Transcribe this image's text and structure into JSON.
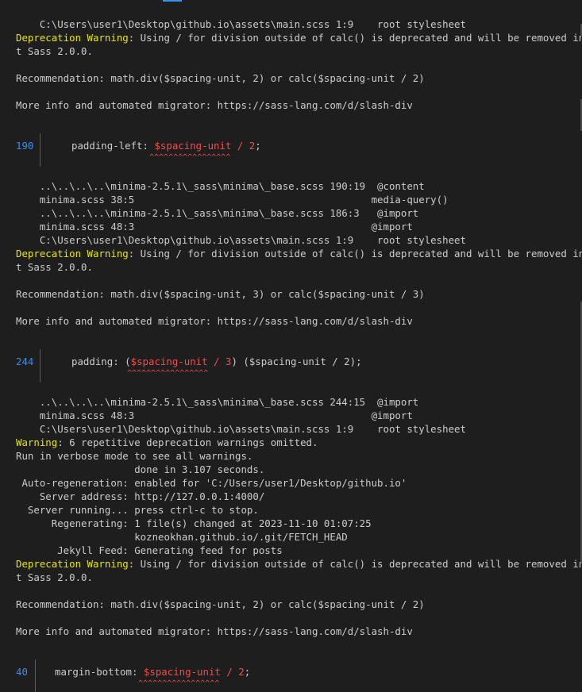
{
  "colors": {
    "background": "#1e1e1e",
    "text": "#cccccc",
    "warning": "#e5e510",
    "error": "#f14c4c",
    "line_number": "#3b8eea"
  },
  "terminal": {
    "lines": {
      "l0": "    C:\\Users\\user1\\Desktop\\github.io\\assets\\main.scss 1:9    root stylesheet",
      "dw1_label": "Deprecation Warning",
      "dw1_rest": ": Using / for division outside of calc() is deprecated and will be removed in Dar",
      "dw1_wrap": "t Sass 2.0.0.",
      "rec1": "Recommendation: math.div($spacing-unit, 2) or calc($spacing-unit / 2)",
      "more1": "More info and automated migrator: https://sass-lang.com/d/slash-div",
      "ln190": "190",
      "code190_pre": "padding-left: ",
      "code190_red": "$spacing-unit / 2",
      "code190_post": ";",
      "caret190": "^^^^^^^^^^^^^^^^^",
      "st1_1": "    ..\\..\\..\\..\\minima-2.5.1\\_sass\\minima\\_base.scss 190:19  @content",
      "st1_2": "    minima.scss 38:5                                        media-query()",
      "st1_3": "    ..\\..\\..\\..\\minima-2.5.1\\_sass\\minima\\_base.scss 186:3   @import",
      "st1_4": "    minima.scss 48:3                                        @import",
      "st1_5": "    C:\\Users\\user1\\Desktop\\github.io\\assets\\main.scss 1:9    root stylesheet",
      "dw2_label": "Deprecation Warning",
      "dw2_rest": ": Using / for division outside of calc() is deprecated and will be removed in Dar",
      "dw2_wrap": "t Sass 2.0.0.",
      "rec2": "Recommendation: math.div($spacing-unit, 3) or calc($spacing-unit / 3)",
      "more2": "More info and automated migrator: https://sass-lang.com/d/slash-div",
      "ln244": "244",
      "code244_pre": "padding: (",
      "code244_red": "$spacing-unit / 3",
      "code244_post": ") ($spacing-unit / 2);",
      "caret244": "^^^^^^^^^^^^^^^^^",
      "st2_1": "    ..\\..\\..\\..\\minima-2.5.1\\_sass\\minima\\_base.scss 244:15  @import",
      "st2_2": "    minima.scss 48:3                                        @import",
      "st2_3": "    C:\\Users\\user1\\Desktop\\github.io\\assets\\main.scss 1:9    root stylesheet",
      "w_label": "Warning",
      "w_rest": ": 6 repetitive deprecation warnings omitted.",
      "verbose": "Run in verbose mode to see all warnings.",
      "done": "                    done in 3.107 seconds.",
      "autoregen": " Auto-regeneration: enabled for 'C:/Users/user1/Desktop/github.io'",
      "server_addr": "    Server address: http://127.0.0.1:4000/",
      "server_run": "  Server running... press ctrl-c to stop.",
      "regen": "      Regenerating: 1 file(s) changed at 2023-11-10 01:07:25",
      "fetch": "                    kozneokhan.github.io/.git/FETCH_HEAD",
      "feed": "       Jekyll Feed: Generating feed for posts",
      "dw3_label": "Deprecation Warning",
      "dw3_rest": ": Using / for division outside of calc() is deprecated and will be removed in Dar",
      "dw3_wrap": "t Sass 2.0.0.",
      "rec3": "Recommendation: math.div($spacing-unit, 2) or calc($spacing-unit / 2)",
      "more3": "More info and automated migrator: https://sass-lang.com/d/slash-div",
      "ln40": "40",
      "code40_pre": "margin-bottom: ",
      "code40_red": "$spacing-unit / 2",
      "code40_post": ";",
      "caret40": "^^^^^^^^^^^^^^^^^"
    }
  }
}
